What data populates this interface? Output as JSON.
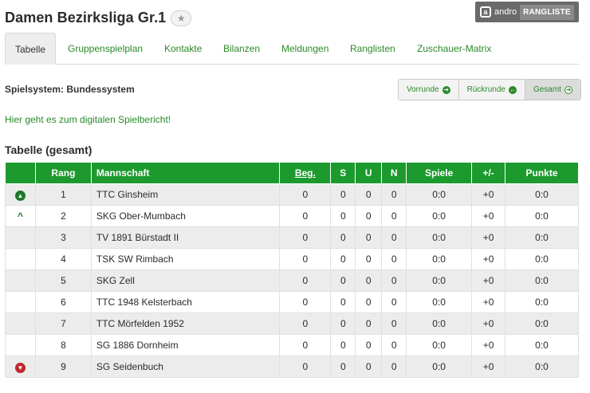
{
  "header": {
    "title": "Damen Bezirksliga Gr.1",
    "favorite_icon": "star-icon",
    "andro": {
      "logo": "a",
      "name": "andro",
      "label": "RANGLISTE"
    }
  },
  "tabs": [
    {
      "label": "Tabelle",
      "active": true
    },
    {
      "label": "Gruppenspielplan"
    },
    {
      "label": "Kontakte"
    },
    {
      "label": "Bilanzen"
    },
    {
      "label": "Meldungen"
    },
    {
      "label": "Ranglisten"
    },
    {
      "label": "Zuschauer-Matrix"
    }
  ],
  "system": {
    "label": "Spielsystem: Bundessystem"
  },
  "rounds": [
    {
      "label": "Vorrunde",
      "icon": "arrow-right-circle-icon",
      "glyph": "➔"
    },
    {
      "label": "Rückrunde",
      "icon": "arrow-left-circle-icon",
      "glyph": "←"
    },
    {
      "label": "Gesamt",
      "icon": "arrow-right-circle-icon",
      "glyph": "➔",
      "active": true
    }
  ],
  "report_link": "Hier geht es zum digitalen Spielbericht!",
  "table": {
    "title": "Tabelle (gesamt)",
    "headers": {
      "icon": "",
      "rank": "Rang",
      "team": "Mannschaft",
      "beg": "Beg.",
      "s": "S",
      "u": "U",
      "n": "N",
      "spiele": "Spiele",
      "diff": "+/-",
      "punkte": "Punkte"
    },
    "rows": [
      {
        "icon": "up-circle",
        "rank": "1",
        "team": "TTC Ginsheim",
        "beg": "0",
        "s": "0",
        "u": "0",
        "n": "0",
        "spiele": "0:0",
        "diff": "+0",
        "punkte": "0:0"
      },
      {
        "icon": "up-chevron",
        "rank": "2",
        "team": "SKG Ober-Mumbach",
        "beg": "0",
        "s": "0",
        "u": "0",
        "n": "0",
        "spiele": "0:0",
        "diff": "+0",
        "punkte": "0:0"
      },
      {
        "icon": "",
        "rank": "3",
        "team": "TV 1891 Bürstadt II",
        "beg": "0",
        "s": "0",
        "u": "0",
        "n": "0",
        "spiele": "0:0",
        "diff": "+0",
        "punkte": "0:0"
      },
      {
        "icon": "",
        "rank": "4",
        "team": "TSK SW Rimbach",
        "beg": "0",
        "s": "0",
        "u": "0",
        "n": "0",
        "spiele": "0:0",
        "diff": "+0",
        "punkte": "0:0"
      },
      {
        "icon": "",
        "rank": "5",
        "team": "SKG Zell",
        "beg": "0",
        "s": "0",
        "u": "0",
        "n": "0",
        "spiele": "0:0",
        "diff": "+0",
        "punkte": "0:0"
      },
      {
        "icon": "",
        "rank": "6",
        "team": "TTC 1948 Kelsterbach",
        "beg": "0",
        "s": "0",
        "u": "0",
        "n": "0",
        "spiele": "0:0",
        "diff": "+0",
        "punkte": "0:0"
      },
      {
        "icon": "",
        "rank": "7",
        "team": "TTC Mörfelden 1952",
        "beg": "0",
        "s": "0",
        "u": "0",
        "n": "0",
        "spiele": "0:0",
        "diff": "+0",
        "punkte": "0:0"
      },
      {
        "icon": "",
        "rank": "8",
        "team": "SG 1886 Dornheim",
        "beg": "0",
        "s": "0",
        "u": "0",
        "n": "0",
        "spiele": "0:0",
        "diff": "+0",
        "punkte": "0:0"
      },
      {
        "icon": "down-circle",
        "rank": "9",
        "team": "SG Seidenbuch",
        "beg": "0",
        "s": "0",
        "u": "0",
        "n": "0",
        "spiele": "0:0",
        "diff": "+0",
        "punkte": "0:0"
      }
    ]
  },
  "colors": {
    "brand_green": "#1c9a2e",
    "link_green": "#2a8a2a",
    "relegation_red": "#c0272d"
  }
}
